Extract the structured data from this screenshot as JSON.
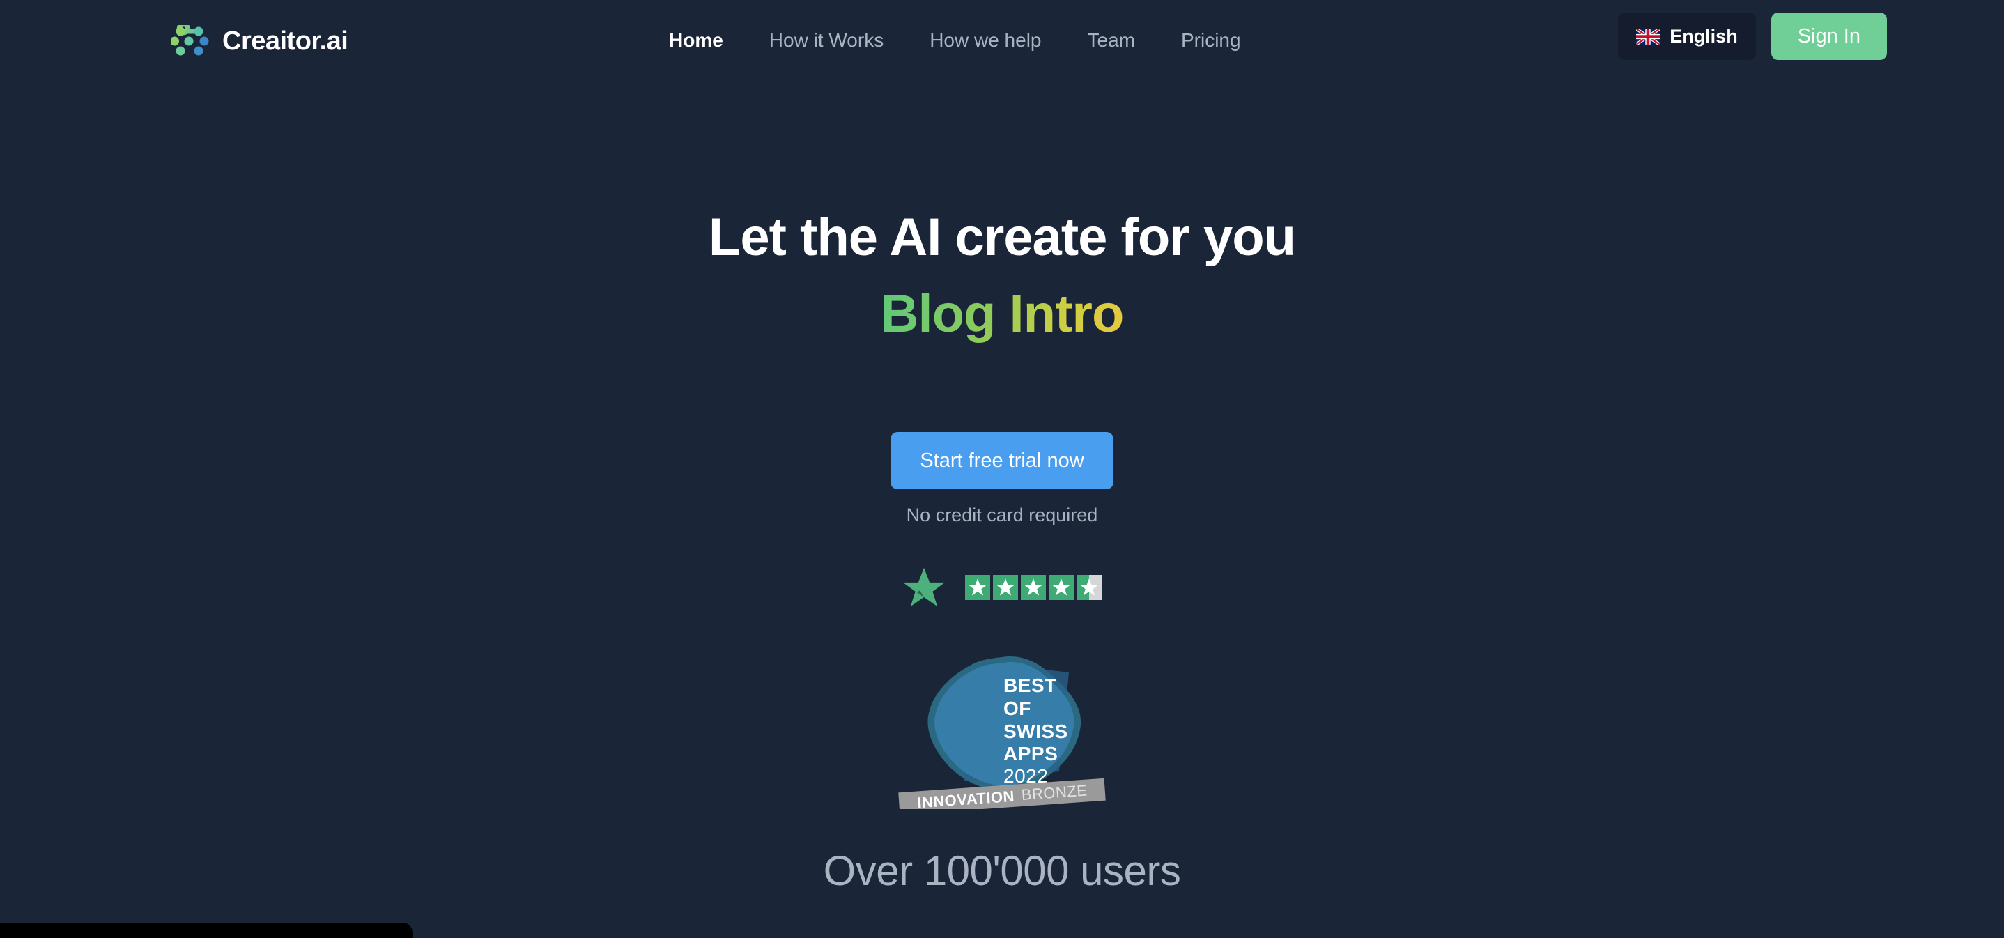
{
  "page": {
    "background_color": "#1a2538",
    "accent_green": "#6fcf97",
    "accent_blue": "#4a9ef0",
    "muted_text_color": "#aab3c2"
  },
  "nav": {
    "brand": {
      "name": "Creaitor.ai",
      "logo_icon": "creaitor-dots-logo-icon"
    },
    "links": [
      {
        "label": "Home",
        "active": true
      },
      {
        "label": "How it Works",
        "active": false
      },
      {
        "label": "How we help",
        "active": false
      },
      {
        "label": "Team",
        "active": false
      },
      {
        "label": "Pricing",
        "active": false
      }
    ],
    "language": {
      "label": "English",
      "flag_icon": "uk-flag-icon"
    },
    "signin": {
      "label": "Sign In"
    }
  },
  "hero": {
    "headline": "Let the AI create for you",
    "subheadline": "Blog Intro",
    "subheadline_gradient_from": "#5ec97a",
    "subheadline_gradient_to": "#e8c93c",
    "cta_label": "Start free trial now",
    "cta_note": "No credit card required",
    "trustpilot": {
      "logo_icon": "trustpilot-star-icon",
      "rating": 4.5,
      "max_rating": 5,
      "star_color": "#3eaa74",
      "empty_color": "#d4d6da"
    },
    "award_badge": {
      "line1": "BEST",
      "line2": "OF",
      "line3": "SWISS",
      "line4": "APPS",
      "line5": "2022",
      "ribbon_bold": "INNOVATION",
      "ribbon_light": "BRONZE",
      "badge_color": "#3c8dbd",
      "ribbon_color": "#9a9a9a"
    },
    "users_line": "Over 100'000 users"
  }
}
